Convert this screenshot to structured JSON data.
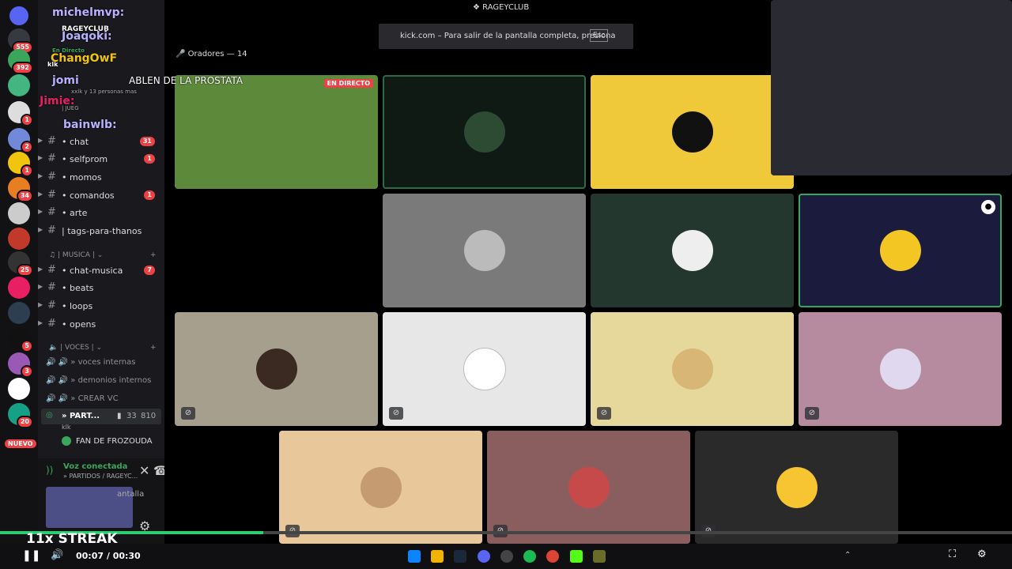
{
  "window": {
    "title": "RAGEYCLUB"
  },
  "fullscreen_notice": {
    "text": "kick.com – Para salir de la pantalla completa, presiona",
    "key": "Esc"
  },
  "speakers_header": "Oradores — 14",
  "live_badge": "EN DIRECTO",
  "overlay": {
    "names": [
      "michelmvp:",
      "RAGEYCLUB",
      "Joaqoki:",
      "En Directo",
      "klk",
      "ChangOwF",
      "jomi",
      "xxlk y 13 personas mas",
      "ABLEN DE LA PROSTATA",
      "Jimie:",
      "| JUEG",
      "bainwlb:"
    ],
    "streak": "11x STREAK"
  },
  "servers": [
    {
      "badge": "555",
      "color": "#5865f2"
    },
    {
      "badge": "392",
      "color": "#3ba55c"
    },
    {
      "badge": "",
      "color": "#43b581"
    },
    {
      "badge": "1",
      "color": "#ddd"
    },
    {
      "badge": "2",
      "color": "#7289da"
    },
    {
      "badge": "1",
      "color": "#f1c40f"
    },
    {
      "badge": "34",
      "color": "#e67e22"
    },
    {
      "badge": "",
      "color": "#ccc"
    },
    {
      "badge": "",
      "color": "#c0392b"
    },
    {
      "badge": "25",
      "color": "#333"
    },
    {
      "badge": "",
      "color": "#e91e63"
    },
    {
      "badge": "",
      "color": "#2c3e50"
    },
    {
      "badge": "5",
      "color": "#111"
    },
    {
      "badge": "3",
      "color": "#9b59b6"
    },
    {
      "badge": "",
      "color": "#fff"
    },
    {
      "badge": "20",
      "color": "#16a085"
    }
  ],
  "new_badge": "NUEVO",
  "channels": [
    {
      "label": "chat",
      "count": "31"
    },
    {
      "label": "selfprom",
      "count": "1"
    },
    {
      "label": "momos",
      "count": ""
    },
    {
      "label": "comandos",
      "count": "1"
    },
    {
      "label": "arte",
      "count": ""
    },
    {
      "label": "tags-para-thanos",
      "count": ""
    }
  ],
  "music_category": "| MUSICA |",
  "music_channels": [
    {
      "label": "chat-musica",
      "count": "7"
    },
    {
      "label": "beats",
      "count": ""
    },
    {
      "label": "loops",
      "count": ""
    },
    {
      "label": "opens",
      "count": ""
    }
  ],
  "voice_category": "| VOCES |",
  "voice_channels": [
    "» voces internas",
    "» demonios internos",
    "» CREAR VC"
  ],
  "active_voice": {
    "label": "» PART...",
    "cam": "33",
    "count": "810",
    "sub": "klk"
  },
  "voice_member": "FAN DE FROZOUDA",
  "voice_status": {
    "title": "Voz conectada",
    "subtitle": "» PARTIDOS / RAGEYC...",
    "screen": "antalla"
  },
  "player": {
    "time": "00:07 / 00:30",
    "progress": 0.26
  },
  "tiles": [
    {
      "color": "#1f1f1f"
    },
    {
      "color": "#0f1a14"
    },
    {
      "color": "#f0c93a"
    },
    {
      "color": "#7a7a7a"
    },
    {
      "color": "#24372f"
    },
    {
      "color": "#1b1b3d"
    },
    {
      "color": "#a79f8e"
    },
    {
      "color": "#e7e7e7"
    },
    {
      "color": "#e6d79b"
    },
    {
      "color": "#b78b9f"
    },
    {
      "color": "#e8c79a"
    },
    {
      "color": "#8a5e5e"
    },
    {
      "color": "#2a2a2a"
    }
  ]
}
